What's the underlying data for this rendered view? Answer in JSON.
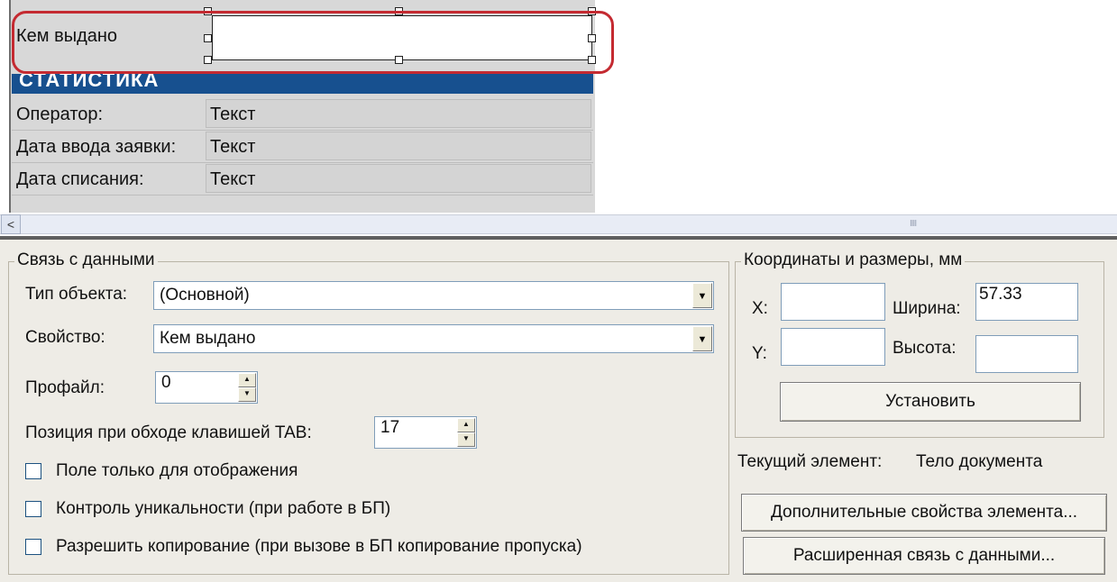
{
  "form": {
    "field_label": "Кем выдано",
    "section_header": "СТАТИСТИКА",
    "rows": [
      {
        "label": "Оператор:",
        "value": "Текст"
      },
      {
        "label": "Дата ввода заявки:",
        "value": "Текст"
      },
      {
        "label": "Дата списания:",
        "value": "Текст"
      }
    ]
  },
  "scrollbar": {
    "left_arrow": "<",
    "grip": "IIII"
  },
  "data_link": {
    "group_title": "Связь с данными",
    "object_type_label": "Тип объекта:",
    "object_type_value": "(Основной)",
    "property_label": "Свойство:",
    "property_value": "Кем выдано",
    "profile_label": "Профайл:",
    "profile_value": "0",
    "tab_position_label": "Позиция при обходе клавишей TAB:",
    "tab_position_value": "17",
    "checkboxes": [
      {
        "label": "Поле только для отображения",
        "checked": false
      },
      {
        "label": "Контроль уникальности (при работе в БП)",
        "checked": false
      },
      {
        "label": "Разрешить копирование (при вызове в БП копирование пропуска)",
        "checked": false
      }
    ]
  },
  "coords": {
    "group_title": "Координаты и размеры, мм",
    "x_label": "X:",
    "x_value": "",
    "y_label": "Y:",
    "y_value": "",
    "width_label": "Ширина:",
    "width_value": "57.33",
    "height_label": "Высота:",
    "height_value": "",
    "set_button": "Установить"
  },
  "current_element": {
    "label": "Текущий элемент:",
    "value": "Тело документа"
  },
  "buttons": {
    "extra_props": "Дополнительные свойства элемента...",
    "extended_link": "Расширенная связь с данными..."
  },
  "colors": {
    "selection_outline": "#c42a31",
    "section_header_bg": "#17508f",
    "panel_bg": "#eeece6"
  }
}
